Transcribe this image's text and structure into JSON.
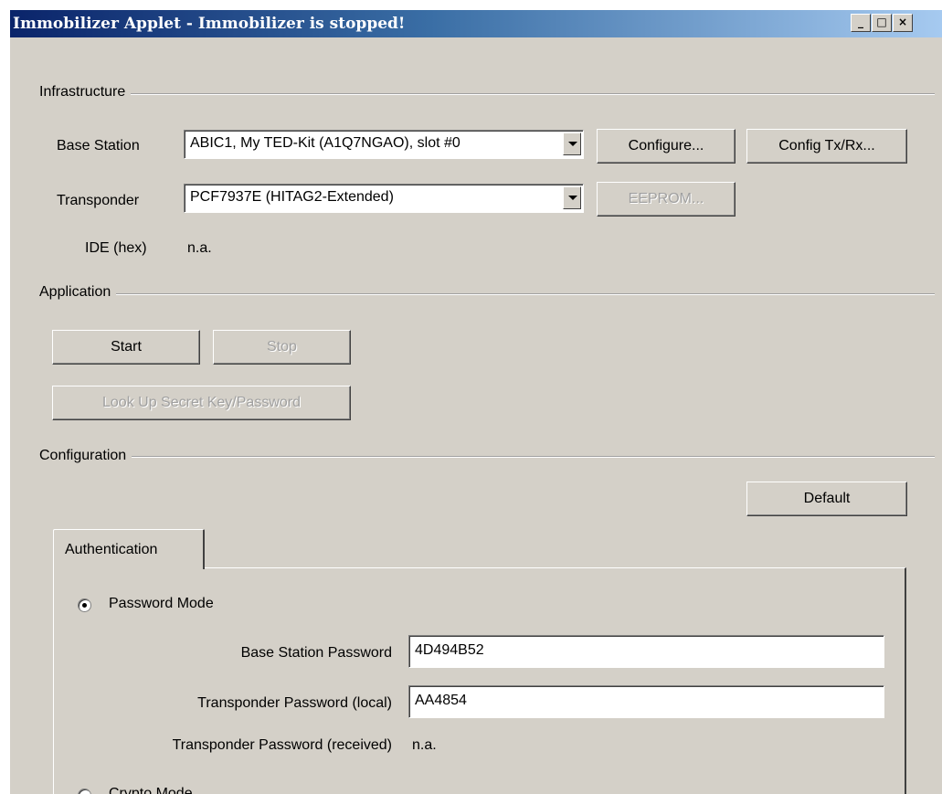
{
  "window": {
    "title": "Immobilizer Applet - Immobilizer is stopped!",
    "controls": {
      "minimize": "_",
      "maximize": "□",
      "close": "×"
    }
  },
  "infrastructure": {
    "group_label": "Infrastructure",
    "base_station_label": "Base Station",
    "base_station_value": "ABIC1, My TED-Kit (A1Q7NGAO), slot #0",
    "configure_button": "Configure...",
    "config_txrx_button": "Config Tx/Rx...",
    "transponder_label": "Transponder",
    "transponder_value": "PCF7937E (HITAG2-Extended)",
    "eeprom_button": "EEPROM...",
    "ide_label": "IDE (hex)",
    "ide_value": "n.a."
  },
  "application": {
    "group_label": "Application",
    "start_button": "Start",
    "stop_button": "Stop",
    "lookup_button": "Look Up Secret Key/Password"
  },
  "configuration": {
    "group_label": "Configuration",
    "default_button": "Default",
    "tab_authentication": "Authentication",
    "password_mode_label": "Password Mode",
    "base_station_password_label": "Base Station Password",
    "base_station_password_value": "4D494B52",
    "transponder_password_local_label": "Transponder Password (local)",
    "transponder_password_local_value": "AA4854",
    "transponder_password_received_label": "Transponder Password (received)",
    "transponder_password_received_value": "n.a.",
    "crypto_mode_label": "Crypto Mode"
  }
}
